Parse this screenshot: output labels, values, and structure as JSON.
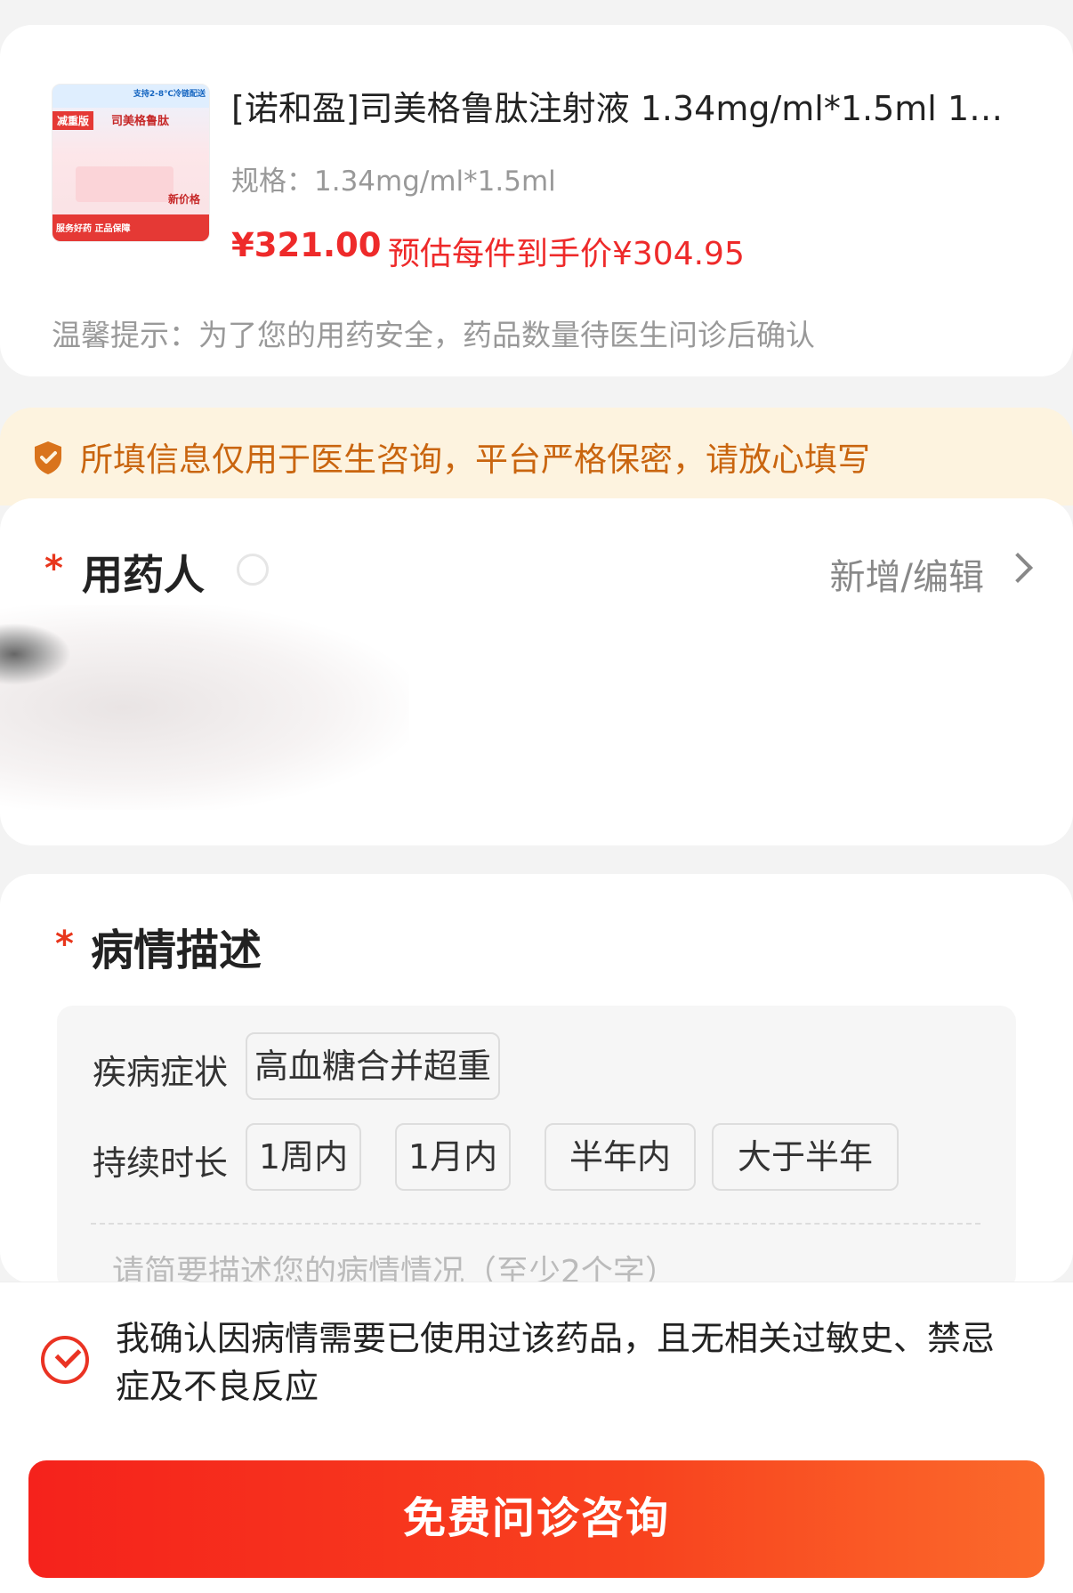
{
  "product": {
    "title": "[诺和盈]司美格鲁肽注射液 1.34mg/ml*1.5ml 1…",
    "spec": "规格：1.34mg/ml*1.5ml",
    "price": "¥321.00",
    "estimated_price": "预估每件到手价¥304.95",
    "tip": "温馨提示：为了您的用药安全，药品数量待医生问诊后确认",
    "image": {
      "top_text": "支持2-8℃冷链配送",
      "badge": "减重版",
      "drug_name": "司美格鲁肽",
      "new_price": "新价格",
      "bottom_text": "服务好药 正品保障"
    }
  },
  "privacy": {
    "icon": "shield-icon",
    "text": "所填信息仅用于医生咨询，平台严格保密，请放心填写"
  },
  "patient": {
    "required": "*",
    "label": "用药人",
    "edit_link": "新增/编辑"
  },
  "condition": {
    "required": "*",
    "label": "病情描述",
    "symptom_label": "疾病症状",
    "symptom_chip": "高血糖合并超重",
    "duration_label": "持续时长",
    "duration_options": [
      "1周内",
      "1月内",
      "半年内",
      "大于半年"
    ],
    "description_placeholder": "请简要描述您的病情情况（至少2个字）"
  },
  "confirm": {
    "checked": true,
    "text": "我确认因病情需要已使用过该药品，且无相关过敏史、禁忌症及不良反应"
  },
  "cta": {
    "label": "免费问诊咨询"
  },
  "colors": {
    "accent_red": "#ee2a2a",
    "privacy_bg": "#fdf3df",
    "privacy_text": "#c9650f"
  }
}
